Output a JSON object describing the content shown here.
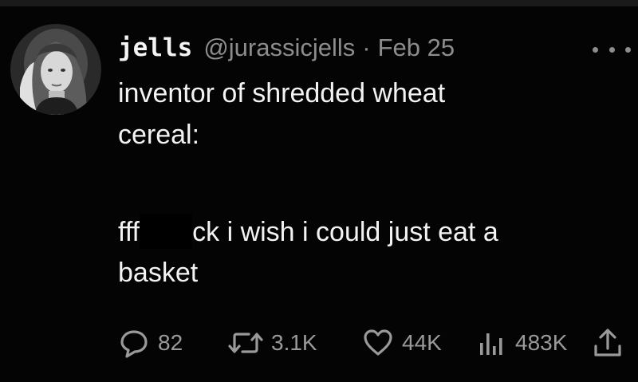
{
  "author": {
    "display_name": "jells",
    "handle": "@jurassicjells",
    "separator": "·",
    "date": "Feb 25"
  },
  "post": {
    "line1_text": "inventor of shredded wheat",
    "line2_text": "cereal:",
    "line3_before_redaction": "fff",
    "line3_after_redaction": "ck i wish i could just eat a",
    "line4_text": "basket"
  },
  "actions": {
    "replies": "82",
    "reposts": "3.1K",
    "likes": "44K",
    "views": "483K"
  },
  "icons": {
    "more": "more-icon",
    "reply": "reply-icon",
    "repost": "repost-icon",
    "like": "heart-icon",
    "views": "views-icon",
    "share": "share-icon"
  },
  "colors": {
    "background": "#040404",
    "text_primary": "#f3f3f3",
    "text_secondary": "#8d8d8d"
  }
}
